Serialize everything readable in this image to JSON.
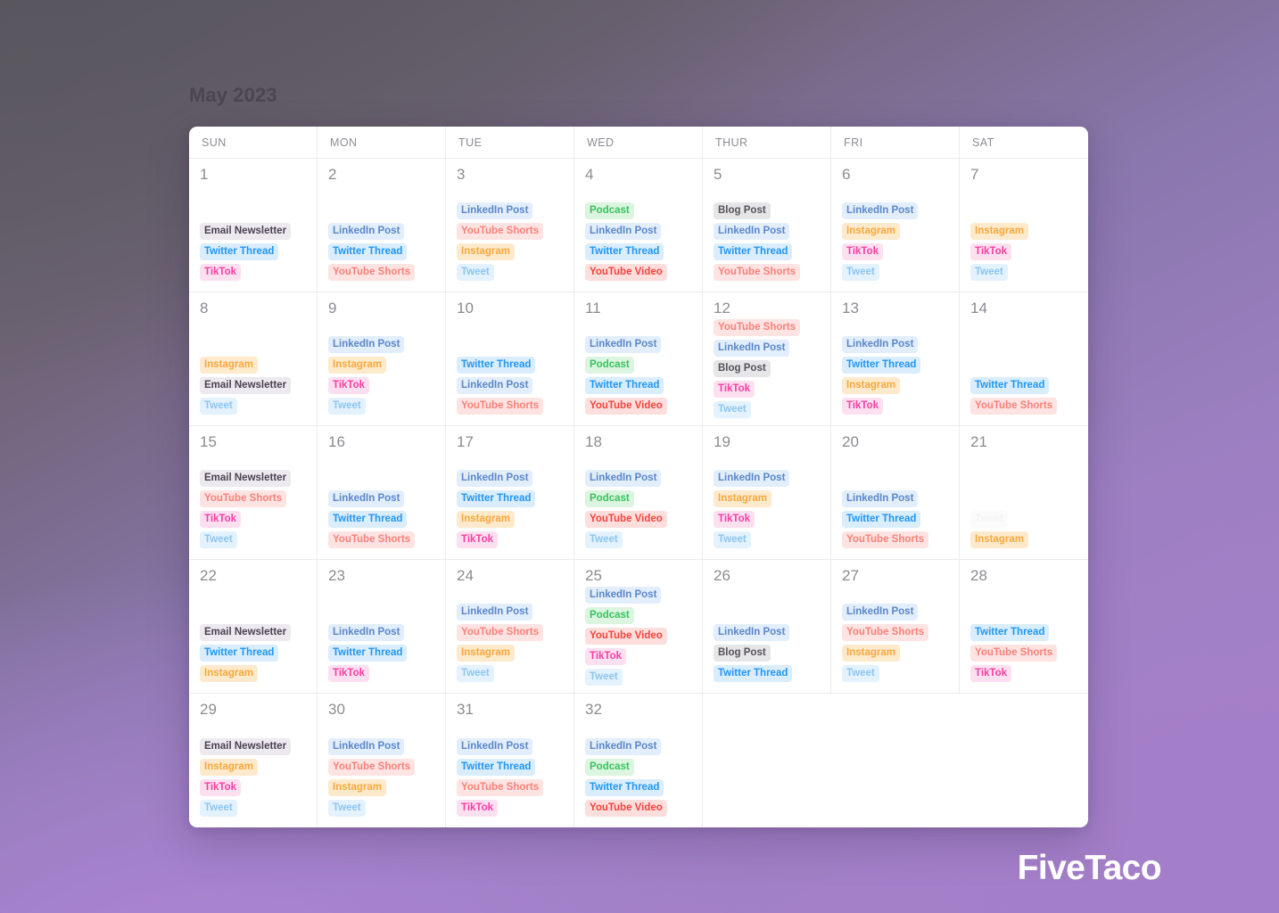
{
  "title": "May 2023",
  "brand": "FiveTaco",
  "day_headers": [
    "SUN",
    "MON",
    "TUE",
    "WED",
    "THUR",
    "FRI",
    "SAT"
  ],
  "tag_colors": {
    "Email Newsletter": "#4b4253",
    "Twitter Thread": "#2196f3",
    "TikTok": "#f83ea4",
    "LinkedIn Post": "#5b87c9",
    "YouTube Shorts": "#f98179",
    "Instagram": "#f7a83c",
    "Tweet": "#8cc5f0",
    "Podcast": "#3ac25e",
    "YouTube Video": "#f4433c",
    "Blog Post": "#55525a"
  },
  "weeks": [
    [
      {
        "day": "1",
        "events": [
          {
            "label": "Email Newsletter",
            "type": "email"
          },
          {
            "label": "Twitter Thread",
            "type": "twitter"
          },
          {
            "label": "TikTok",
            "type": "tiktok"
          }
        ]
      },
      {
        "day": "2",
        "events": [
          {
            "label": "LinkedIn Post",
            "type": "linkedin"
          },
          {
            "label": "Twitter Thread",
            "type": "twitter"
          },
          {
            "label": "YouTube Shorts",
            "type": "ytshorts"
          }
        ]
      },
      {
        "day": "3",
        "events": [
          {
            "label": "LinkedIn Post",
            "type": "linkedin"
          },
          {
            "label": "YouTube Shorts",
            "type": "ytshorts"
          },
          {
            "label": "Instagram",
            "type": "instagram"
          },
          {
            "label": "Tweet",
            "type": "tweet"
          }
        ]
      },
      {
        "day": "4",
        "events": [
          {
            "label": "Podcast",
            "type": "podcast"
          },
          {
            "label": "LinkedIn Post",
            "type": "linkedin"
          },
          {
            "label": "Twitter Thread",
            "type": "twitter"
          },
          {
            "label": "YouTube Video",
            "type": "ytvideo"
          }
        ]
      },
      {
        "day": "5",
        "events": [
          {
            "label": "Blog Post",
            "type": "blog"
          },
          {
            "label": "LinkedIn Post",
            "type": "linkedin"
          },
          {
            "label": "Twitter Thread",
            "type": "twitter"
          },
          {
            "label": "YouTube Shorts",
            "type": "ytshorts"
          }
        ]
      },
      {
        "day": "6",
        "events": [
          {
            "label": "LinkedIn Post",
            "type": "linkedin"
          },
          {
            "label": "Instagram",
            "type": "instagram"
          },
          {
            "label": "TikTok",
            "type": "tiktok"
          },
          {
            "label": "Tweet",
            "type": "tweet"
          }
        ]
      },
      {
        "day": "7",
        "events": [
          {
            "label": "Instagram",
            "type": "instagram"
          },
          {
            "label": "TikTok",
            "type": "tiktok"
          },
          {
            "label": "Tweet",
            "type": "tweet"
          }
        ]
      }
    ],
    [
      {
        "day": "8",
        "events": [
          {
            "label": "Instagram",
            "type": "instagram"
          },
          {
            "label": "Email Newsletter",
            "type": "email"
          },
          {
            "label": "Tweet",
            "type": "tweet"
          }
        ]
      },
      {
        "day": "9",
        "events": [
          {
            "label": "LinkedIn Post",
            "type": "linkedin"
          },
          {
            "label": "Instagram",
            "type": "instagram"
          },
          {
            "label": "TikTok",
            "type": "tiktok"
          },
          {
            "label": "Tweet",
            "type": "tweet"
          }
        ]
      },
      {
        "day": "10",
        "events": [
          {
            "label": "Twitter Thread",
            "type": "twitter"
          },
          {
            "label": "LinkedIn Post",
            "type": "linkedin"
          },
          {
            "label": "YouTube Shorts",
            "type": "ytshorts"
          }
        ]
      },
      {
        "day": "11",
        "events": [
          {
            "label": "LinkedIn Post",
            "type": "linkedin"
          },
          {
            "label": "Podcast",
            "type": "podcast"
          },
          {
            "label": "Twitter Thread",
            "type": "twitter"
          },
          {
            "label": "YouTube Video",
            "type": "ytvideo"
          }
        ]
      },
      {
        "day": "12",
        "events": [
          {
            "label": "YouTube Shorts",
            "type": "ytshorts"
          },
          {
            "label": "LinkedIn Post",
            "type": "linkedin"
          },
          {
            "label": "Blog Post",
            "type": "blog"
          },
          {
            "label": "TikTok",
            "type": "tiktok"
          },
          {
            "label": "Tweet",
            "type": "tweet"
          }
        ]
      },
      {
        "day": "13",
        "events": [
          {
            "label": "LinkedIn Post",
            "type": "linkedin"
          },
          {
            "label": "Twitter Thread",
            "type": "twitter"
          },
          {
            "label": "Instagram",
            "type": "instagram"
          },
          {
            "label": "TikTok",
            "type": "tiktok"
          }
        ]
      },
      {
        "day": "14",
        "events": [
          {
            "label": "Twitter Thread",
            "type": "twitter"
          },
          {
            "label": "YouTube Shorts",
            "type": "ytshorts"
          }
        ]
      }
    ],
    [
      {
        "day": "15",
        "events": [
          {
            "label": "Email Newsletter",
            "type": "email"
          },
          {
            "label": "YouTube Shorts",
            "type": "ytshorts"
          },
          {
            "label": "TikTok",
            "type": "tiktok"
          },
          {
            "label": "Tweet",
            "type": "tweet"
          }
        ]
      },
      {
        "day": "16",
        "events": [
          {
            "label": "LinkedIn Post",
            "type": "linkedin"
          },
          {
            "label": "Twitter Thread",
            "type": "twitter"
          },
          {
            "label": "YouTube Shorts",
            "type": "ytshorts"
          }
        ]
      },
      {
        "day": "17",
        "events": [
          {
            "label": "LinkedIn Post",
            "type": "linkedin"
          },
          {
            "label": "Twitter Thread",
            "type": "twitter"
          },
          {
            "label": "Instagram",
            "type": "instagram"
          },
          {
            "label": "TikTok",
            "type": "tiktok"
          }
        ]
      },
      {
        "day": "18",
        "events": [
          {
            "label": "LinkedIn Post",
            "type": "linkedin"
          },
          {
            "label": "Podcast",
            "type": "podcast"
          },
          {
            "label": "YouTube Video",
            "type": "ytvideo"
          },
          {
            "label": "Tweet",
            "type": "tweet"
          }
        ]
      },
      {
        "day": "19",
        "events": [
          {
            "label": "LinkedIn Post",
            "type": "linkedin"
          },
          {
            "label": "Instagram",
            "type": "instagram"
          },
          {
            "label": "TikTok",
            "type": "tiktok"
          },
          {
            "label": "Tweet",
            "type": "tweet"
          }
        ]
      },
      {
        "day": "20",
        "events": [
          {
            "label": "LinkedIn Post",
            "type": "linkedin"
          },
          {
            "label": "Twitter Thread",
            "type": "twitter"
          },
          {
            "label": "YouTube Shorts",
            "type": "ytshorts"
          }
        ]
      },
      {
        "day": "21",
        "events": [
          {
            "label": "Tweet",
            "type": "ghost"
          },
          {
            "label": "Instagram",
            "type": "instagram"
          }
        ]
      }
    ],
    [
      {
        "day": "22",
        "events": [
          {
            "label": "Email Newsletter",
            "type": "email"
          },
          {
            "label": "Twitter Thread",
            "type": "twitter"
          },
          {
            "label": "Instagram",
            "type": "instagram"
          }
        ]
      },
      {
        "day": "23",
        "events": [
          {
            "label": "LinkedIn Post",
            "type": "linkedin"
          },
          {
            "label": "Twitter Thread",
            "type": "twitter"
          },
          {
            "label": "TikTok",
            "type": "tiktok"
          }
        ]
      },
      {
        "day": "24",
        "events": [
          {
            "label": "LinkedIn Post",
            "type": "linkedin"
          },
          {
            "label": "YouTube Shorts",
            "type": "ytshorts"
          },
          {
            "label": "Instagram",
            "type": "instagram"
          },
          {
            "label": "Tweet",
            "type": "tweet"
          }
        ]
      },
      {
        "day": "25",
        "events": [
          {
            "label": "LinkedIn Post",
            "type": "linkedin"
          },
          {
            "label": "Podcast",
            "type": "podcast"
          },
          {
            "label": "YouTube Video",
            "type": "ytvideo"
          },
          {
            "label": "TikTok",
            "type": "tiktok"
          },
          {
            "label": "Tweet",
            "type": "tweet"
          }
        ]
      },
      {
        "day": "26",
        "events": [
          {
            "label": "LinkedIn Post",
            "type": "linkedin"
          },
          {
            "label": "Blog Post",
            "type": "blog"
          },
          {
            "label": "Twitter Thread",
            "type": "twitter"
          }
        ]
      },
      {
        "day": "27",
        "events": [
          {
            "label": "LinkedIn Post",
            "type": "linkedin"
          },
          {
            "label": "YouTube Shorts",
            "type": "ytshorts"
          },
          {
            "label": "Instagram",
            "type": "instagram"
          },
          {
            "label": "Tweet",
            "type": "tweet"
          }
        ]
      },
      {
        "day": "28",
        "events": [
          {
            "label": "Twitter Thread",
            "type": "twitter"
          },
          {
            "label": "YouTube Shorts",
            "type": "ytshorts"
          },
          {
            "label": "TikTok",
            "type": "tiktok"
          }
        ]
      }
    ],
    [
      {
        "day": "29",
        "events": [
          {
            "label": "Email Newsletter",
            "type": "email"
          },
          {
            "label": "Instagram",
            "type": "instagram"
          },
          {
            "label": "TikTok",
            "type": "tiktok"
          },
          {
            "label": "Tweet",
            "type": "tweet"
          }
        ]
      },
      {
        "day": "30",
        "events": [
          {
            "label": "LinkedIn Post",
            "type": "linkedin"
          },
          {
            "label": "YouTube Shorts",
            "type": "ytshorts"
          },
          {
            "label": "Instagram",
            "type": "instagram"
          },
          {
            "label": "Tweet",
            "type": "tweet"
          }
        ]
      },
      {
        "day": "31",
        "events": [
          {
            "label": "LinkedIn Post",
            "type": "linkedin"
          },
          {
            "label": "Twitter Thread",
            "type": "twitter"
          },
          {
            "label": "YouTube Shorts",
            "type": "ytshorts"
          },
          {
            "label": "TikTok",
            "type": "tiktok"
          }
        ]
      },
      {
        "day": "32",
        "events": [
          {
            "label": "LinkedIn Post",
            "type": "linkedin"
          },
          {
            "label": "Podcast",
            "type": "podcast"
          },
          {
            "label": "Twitter Thread",
            "type": "twitter"
          },
          {
            "label": "YouTube Video",
            "type": "ytvideo"
          }
        ]
      },
      {
        "day": "",
        "empty": true
      },
      {
        "day": "",
        "empty": true
      },
      {
        "day": "",
        "empty": true
      }
    ]
  ]
}
